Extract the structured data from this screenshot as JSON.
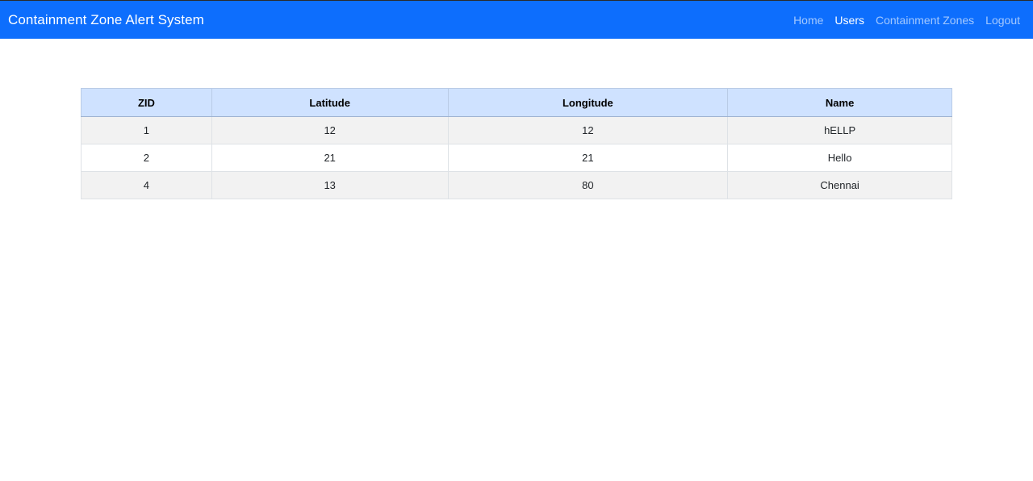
{
  "navbar": {
    "brand": "Containment Zone Alert System",
    "links": [
      {
        "label": "Home",
        "active": false
      },
      {
        "label": "Users",
        "active": true
      },
      {
        "label": "Containment Zones",
        "active": false
      },
      {
        "label": "Logout",
        "active": false
      }
    ]
  },
  "table": {
    "headers": [
      "ZID",
      "Latitude",
      "Longitude",
      "Name"
    ],
    "rows": [
      [
        "1",
        "12",
        "12",
        "hELLP"
      ],
      [
        "2",
        "21",
        "21",
        "Hello"
      ],
      [
        "4",
        "13",
        "80",
        "Chennai"
      ]
    ]
  },
  "colors": {
    "navbar_bg": "#0d6efd",
    "header_bg": "#cfe2ff",
    "stripe_bg": "#f2f2f2"
  }
}
